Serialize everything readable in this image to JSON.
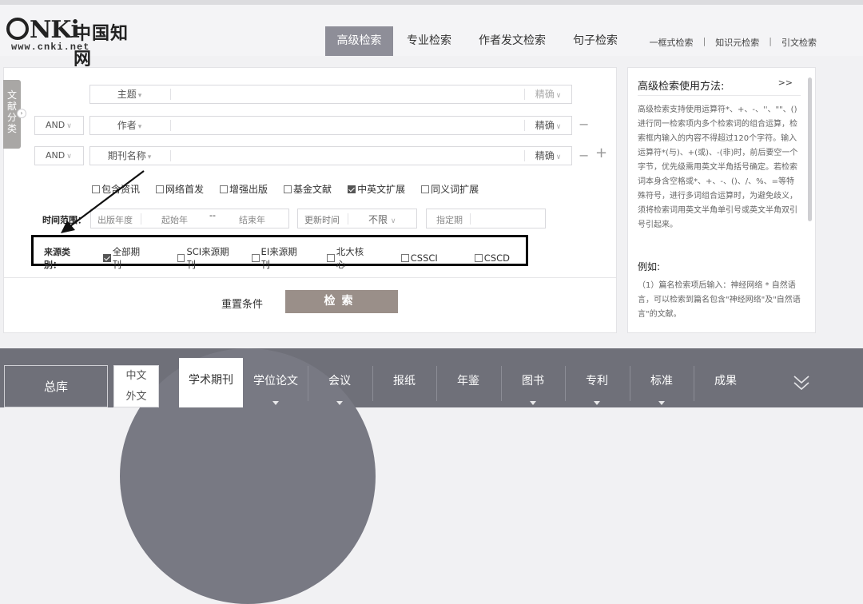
{
  "logo": {
    "brand": "NKi",
    "cn": "中国知网",
    "url": "www.cnki.net"
  },
  "tabs": [
    "高级检索",
    "专业检索",
    "作者发文检索",
    "句子检索"
  ],
  "top_links": [
    "一框式检索",
    "知识元检索",
    "引文检索"
  ],
  "side_tag": "文献分类",
  "rows": [
    {
      "logic": "",
      "field": "主题",
      "match": "精确"
    },
    {
      "logic": "AND",
      "field": "作者",
      "match": "精确"
    },
    {
      "logic": "AND",
      "field": "期刊名称",
      "match": "精确"
    }
  ],
  "options": [
    {
      "label": "包含资讯",
      "checked": false
    },
    {
      "label": "网络首发",
      "checked": false
    },
    {
      "label": "增强出版",
      "checked": false
    },
    {
      "label": "基金文献",
      "checked": false
    },
    {
      "label": "中英文扩展",
      "checked": true
    },
    {
      "label": "同义词扩展",
      "checked": false
    }
  ],
  "time": {
    "label": "时间范围：",
    "pub_year": "出版年度",
    "start": "起始年",
    "dash": "--",
    "end": "结束年",
    "update_label": "更新时间",
    "update_value": "不限",
    "specify": "指定期"
  },
  "source": {
    "label": "来源类别：",
    "items": [
      {
        "label": "全部期刊",
        "checked": true
      },
      {
        "label": "SCI来源期刊",
        "checked": false
      },
      {
        "label": "EI来源期刊",
        "checked": false
      },
      {
        "label": "北大核心",
        "checked": false
      },
      {
        "label": "CSSCI",
        "checked": false
      },
      {
        "label": "CSCD",
        "checked": false
      }
    ]
  },
  "actions": {
    "reset": "重置条件",
    "search": "检索"
  },
  "help": {
    "title": "高级检索使用方法:",
    "more": ">>",
    "body": "高级检索支持使用运算符*、+、-、''、\"\"、()进行同一检索项内多个检索词的组合运算，检索框内输入的内容不得超过120个字符。输入运算符*(与)、+(或)、-(非)时，前后要空一个字节，优先级需用英文半角括号确定。若检索词本身含空格或*、+、-、()、/、%、=等特殊符号，进行多词组合运算时，为避免歧义，须将检索词用英文半角单引号或英文半角双引号引起来。",
    "example_title": "例如:",
    "example": "（1）篇名检索项后输入：神经网络 * 自然语言，可以检索到篇名包含\"神经网络\"及\"自然语言\"的文献。"
  },
  "bottom": {
    "all": "总库",
    "lang": [
      "中文",
      "外文"
    ],
    "active": "学术期刊",
    "items": [
      "学位论文",
      "会议",
      "报纸",
      "年鉴",
      "图书",
      "专利",
      "标准",
      "成果"
    ]
  }
}
